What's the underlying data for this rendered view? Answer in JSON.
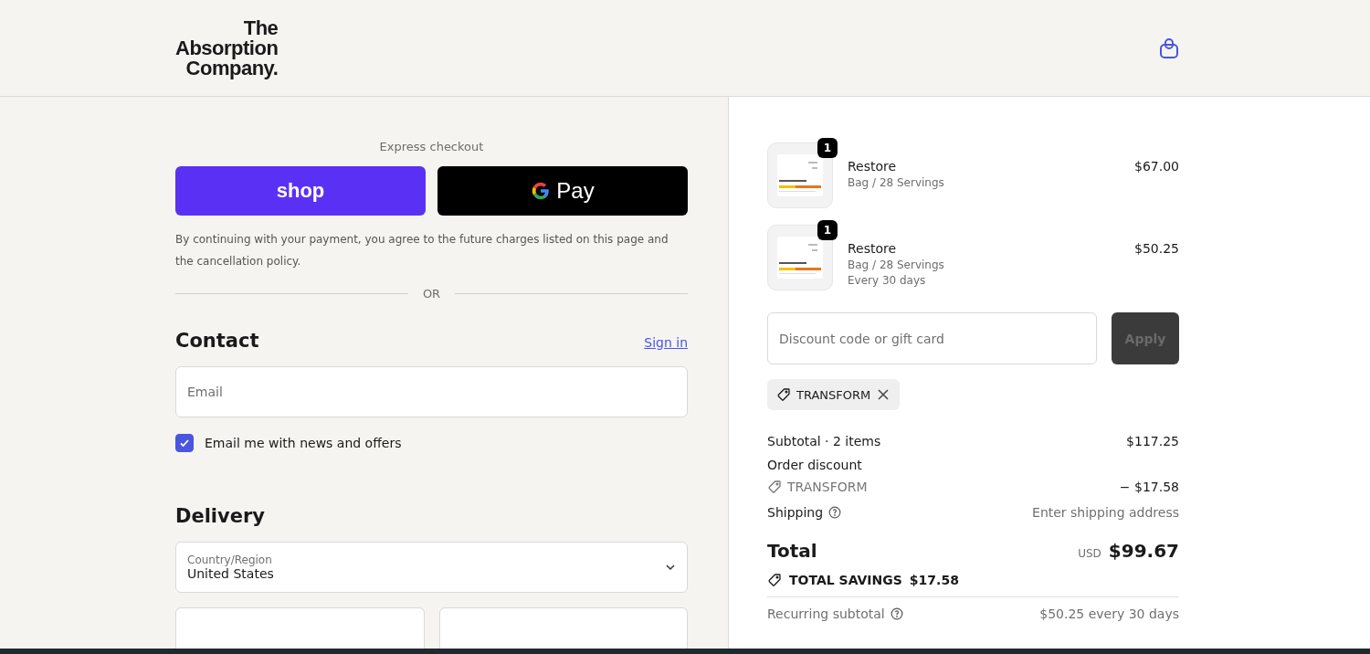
{
  "header": {
    "logo_lines": [
      "The",
      "Absorption",
      "Company."
    ]
  },
  "express": {
    "title": "Express checkout",
    "shop_label": "shop",
    "gpay_label": "Pay",
    "disclaimer": "By continuing with your payment, you agree to the future charges listed on this page and the cancellation policy.",
    "divider": "OR"
  },
  "contact": {
    "title": "Contact",
    "sign_in": "Sign in",
    "email": {
      "placeholder": "Email"
    },
    "newsletter": {
      "label": "Email me with news and offers",
      "checked": true
    }
  },
  "delivery": {
    "title": "Delivery",
    "country": {
      "label": "Country/Region",
      "value": "United States"
    }
  },
  "items": [
    {
      "quantity": "1",
      "name": "Restore",
      "lines": [
        "Bag / 28 Servings"
      ],
      "price": "$67.00"
    },
    {
      "quantity": "1",
      "name": "Restore",
      "lines": [
        "Bag / 28 Servings",
        "Every 30 days"
      ],
      "price": "$50.25"
    }
  ],
  "discount": {
    "placeholder": "Discount code or gift card",
    "apply": "Apply",
    "disabled": true,
    "applied_code": "TRANSFORM"
  },
  "summary": {
    "subtotal_label": "Subtotal · 2 items",
    "subtotal": "$117.25",
    "order_discount": "Order discount",
    "discount_code": "TRANSFORM",
    "discount_amount": "− $17.58",
    "shipping_label": "Shipping",
    "shipping_value": "Enter shipping address",
    "total_label": "Total",
    "currency": "USD",
    "total": "$99.67",
    "savings_label": "TOTAL SAVINGS",
    "savings": "$17.58",
    "recurring_label": "Recurring subtotal",
    "recurring_value": "$50.25 every 30 days"
  }
}
